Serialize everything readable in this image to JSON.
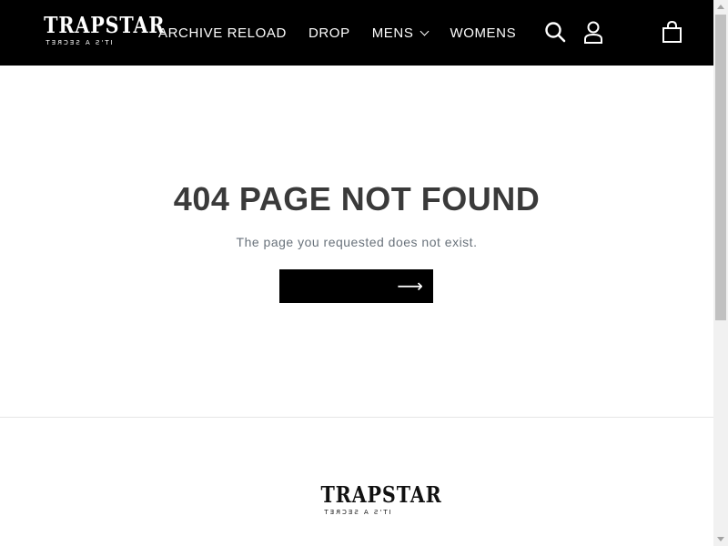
{
  "header": {
    "logo": {
      "main": "TRAPSTAR",
      "sub": "IT'S A SECRET"
    },
    "nav": [
      {
        "label": "ARCHIVE RELOAD"
      },
      {
        "label": "DROP"
      },
      {
        "label": "MENS",
        "has_dropdown": true
      },
      {
        "label": "WOMENS"
      }
    ],
    "icons": [
      "search-icon",
      "account-icon",
      "cart-icon"
    ]
  },
  "main": {
    "title": "404 PAGE NOT FOUND",
    "message": "The page you requested does not exist.",
    "button_arrow": "⟶"
  },
  "footer": {
    "logo": {
      "main": "TRAPSTAR",
      "sub": "IT'S A SECRET"
    }
  },
  "colors": {
    "header_bg": "#000000",
    "title_text": "#3a3a3a",
    "message_text": "#69727b",
    "button_bg": "#000000"
  }
}
